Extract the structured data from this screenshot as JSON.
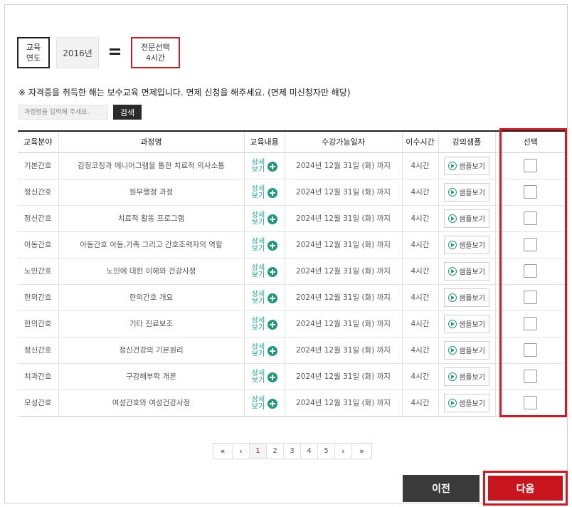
{
  "summary": {
    "year_label_line1": "교육",
    "year_label_line2": "연도",
    "year_value": "2016년",
    "hours_line1": "전문선택",
    "hours_line2": "4시간"
  },
  "notice": "※ 자격증을 취득한 해는 보수교육 면제입니다. 면제 신청을 해주세요. (면제 미신청자만 해당)",
  "search": {
    "placeholder": "과정명을 입력해 주세요.",
    "button_label": "검색"
  },
  "table": {
    "headers": [
      "교육분야",
      "과정명",
      "교육내용",
      "수강가능일자",
      "이수시간",
      "강의샘플",
      "선택"
    ],
    "detail_label_top": "상세",
    "detail_label_bottom": "보기",
    "sample_label": "샘플보기",
    "rows": [
      {
        "field": "기본간호",
        "course": "감정코칭과 에니어그램을 통한 치료적 의사소통",
        "period": "2024년 12월 31일 (화) 까지",
        "hours": "4시간"
      },
      {
        "field": "정신간호",
        "course": "원무행정 과정",
        "period": "2024년 12월 31일 (화) 까지",
        "hours": "4시간"
      },
      {
        "field": "정신간호",
        "course": "치료적 활동 프로그램",
        "period": "2024년 12월 31일 (화) 까지",
        "hours": "4시간"
      },
      {
        "field": "아동간호",
        "course": "아동간호 아동,가족 그리고 간호조력자의 역할",
        "period": "2024년 12월 31일 (화) 까지",
        "hours": "4시간"
      },
      {
        "field": "노인간호",
        "course": "노인에 대한 이해와 건강사정",
        "period": "2024년 12월 31일 (화) 까지",
        "hours": "4시간"
      },
      {
        "field": "한의간호",
        "course": "한의간호 개요",
        "period": "2024년 12월 31일 (화) 까지",
        "hours": "4시간"
      },
      {
        "field": "한의간호",
        "course": "기타 진료보조",
        "period": "2024년 12월 31일 (화) 까지",
        "hours": "4시간"
      },
      {
        "field": "정신간호",
        "course": "정신건강의 기본원리",
        "period": "2024년 12월 31일 (화) 까지",
        "hours": "4시간"
      },
      {
        "field": "치과간호",
        "course": "구강해부학 개론",
        "period": "2024년 12월 31일 (화) 까지",
        "hours": "4시간"
      },
      {
        "field": "모성간호",
        "course": "여성간호와 여성건강사정",
        "period": "2024년 12월 31일 (화) 까지",
        "hours": "4시간"
      }
    ]
  },
  "pagination": {
    "first": "«",
    "prev": "‹",
    "pages": [
      "1",
      "2",
      "3",
      "4",
      "5"
    ],
    "current_page": "1",
    "next": "›",
    "last": "»"
  },
  "buttons": {
    "prev_label": "이전",
    "next_label": "다음"
  },
  "colors": {
    "accent_red": "#c8151d",
    "highlight_red": "#d7191f",
    "teal": "#1c9a7b",
    "dark_button": "#3a3a3a"
  }
}
